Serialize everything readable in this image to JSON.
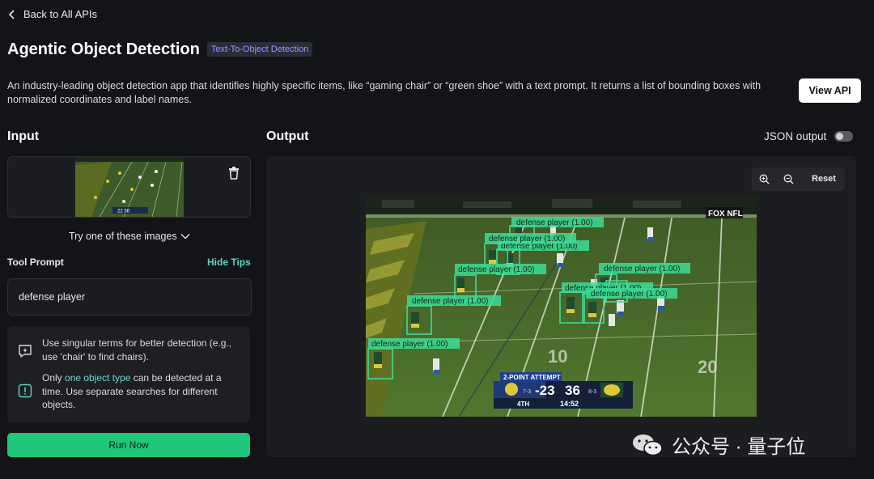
{
  "nav": {
    "back_label": "Back to All APIs"
  },
  "header": {
    "title": "Agentic Object Detection",
    "badge": "Text-To-Object Detection",
    "description": "An industry-leading object detection app that identifies highly specific items, like “gaming chair” or “green shoe” with a text prompt. It returns a list of bounding boxes with normalized coordinates and label names.",
    "view_api_label": "View API"
  },
  "input": {
    "section_title": "Input",
    "try_images_label": "Try one of these images",
    "tool_prompt_label": "Tool Prompt",
    "hide_tips_label": "Hide Tips",
    "prompt_value": "defense player",
    "tips": {
      "tip1": "Use singular terms for better detection (e.g., use 'chair' to find chairs).",
      "tip2_before": "Only ",
      "tip2_link": "one object type",
      "tip2_after": " can be detected at a time. Use separate searches for different objects."
    },
    "run_label": "Run Now",
    "thumbnail_score": "22 36"
  },
  "output": {
    "section_title": "Output",
    "json_toggle_label": "JSON output",
    "json_toggle_on": false,
    "reset_label": "Reset",
    "detection_label": "defense player (1.00)",
    "scorebug": {
      "banner": "2-POINT ATTEMPT",
      "away_record": "7-3",
      "away_score": "-23",
      "home_score": "36",
      "home_record": "8-3",
      "quarter": "4TH",
      "clock": "14:52",
      "network": "FOX NFL"
    },
    "field_numbers": [
      "10",
      "20"
    ]
  },
  "watermark": "公众号 · 量子位",
  "colors": {
    "background": "#131417",
    "accent_green": "#1ec77a",
    "link_teal": "#5fd4c3",
    "badge_text": "#8f9cff",
    "detection_box": "#3ddc97"
  }
}
